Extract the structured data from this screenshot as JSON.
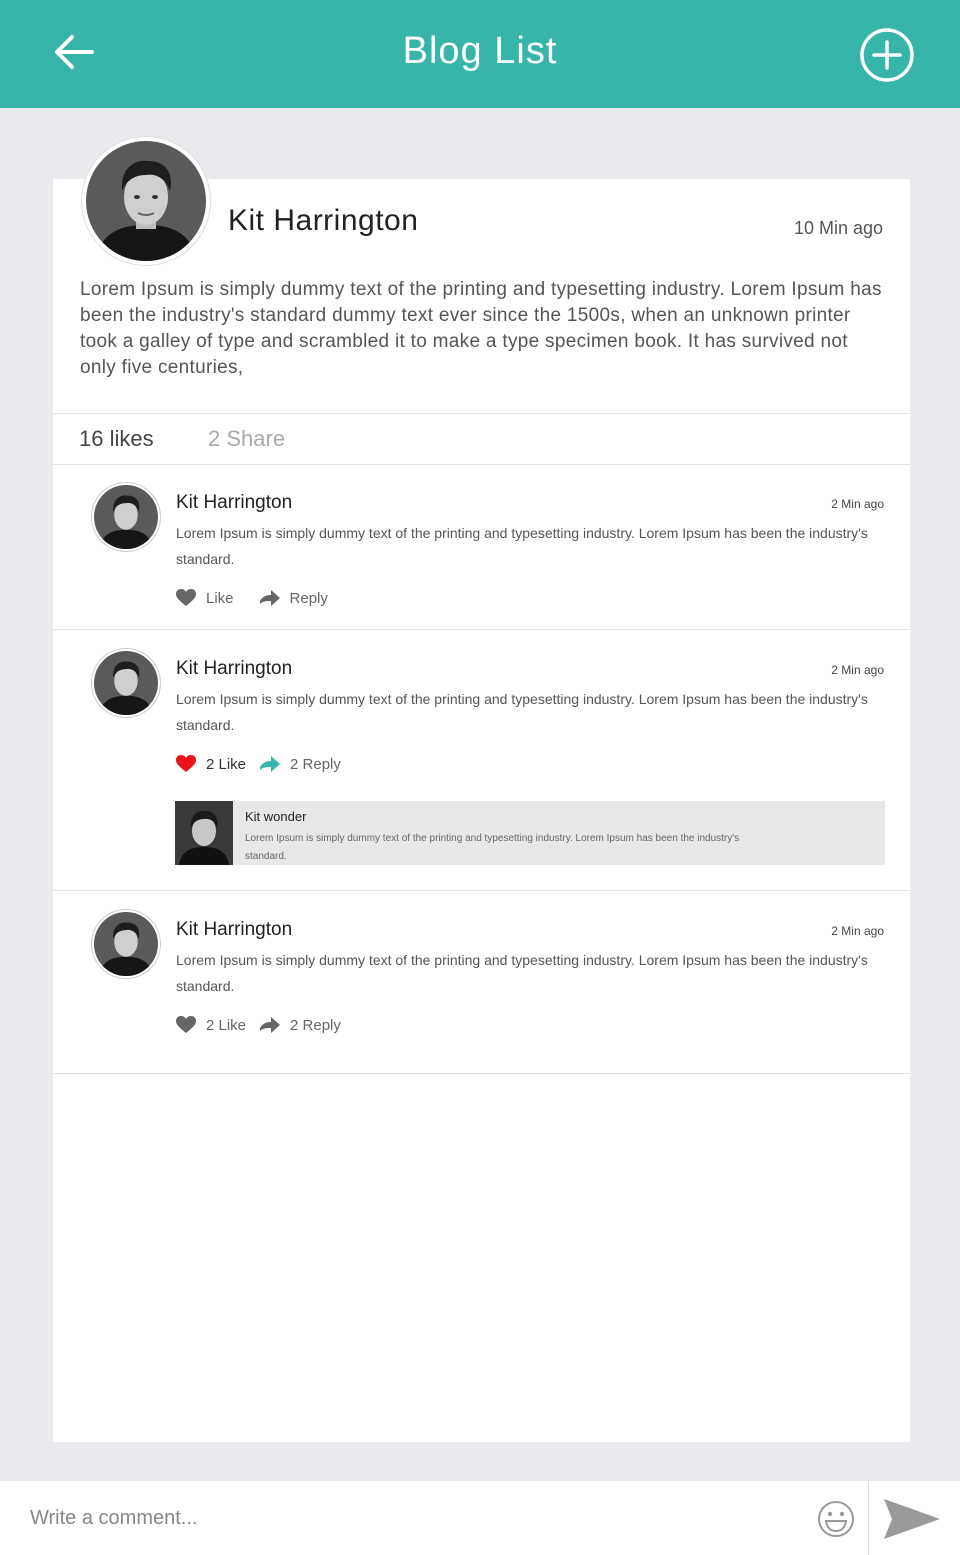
{
  "header": {
    "title": "Blog List",
    "back_icon": "arrow-left-icon",
    "add_icon": "plus-circle-icon",
    "color": "#36b5a8"
  },
  "post": {
    "author": "Kit Harrington",
    "time": "10 Min ago",
    "body": "Lorem Ipsum is simply dummy text of the printing and typesetting industry. Lorem Ipsum has been the industry's standard dummy text ever since the 1500s, when an unknown printer took a galley of type and scrambled it to make a type specimen book. It has survived not only five centuries,",
    "likes": "16 likes",
    "shares": "2 Share"
  },
  "comments": [
    {
      "author": "Kit Harrington",
      "time": "2 Min ago",
      "text": "Lorem Ipsum is simply dummy text of the printing and typesetting industry. Lorem Ipsum has been the industry's standard.",
      "like_label": "Like",
      "reply_label": "Reply",
      "liked": false
    },
    {
      "author": "Kit Harrington",
      "time": "2 Min ago",
      "text": "Lorem Ipsum is simply dummy text of the printing and typesetting industry. Lorem Ipsum has been the industry's standard.",
      "like_label": "2 Like",
      "reply_label": "2 Reply",
      "liked": true,
      "reply": {
        "author": "Kit wonder",
        "text": "Lorem Ipsum is simply dummy text of the printing and typesetting industry. Lorem Ipsum has been the industry's standard."
      }
    },
    {
      "author": "Kit Harrington",
      "time": "2 Min ago",
      "text": "Lorem Ipsum is simply dummy text of the printing and typesetting industry. Lorem Ipsum has been the industry's standard.",
      "like_label": "2 Like",
      "reply_label": "2 Reply",
      "liked": false
    }
  ],
  "compose": {
    "placeholder": "Write a comment...",
    "emoji_icon": "smiley-icon",
    "send_icon": "send-icon"
  },
  "colors": {
    "accent": "#36b5a8",
    "liked_heart": "#e8131b",
    "background": "#e9eaed"
  }
}
